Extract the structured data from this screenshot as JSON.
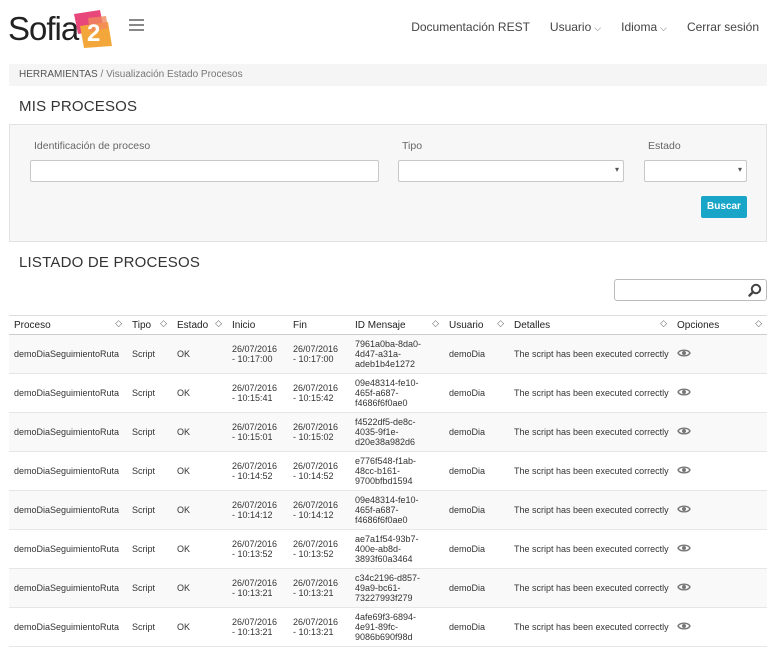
{
  "brand": {
    "name": "Sofia",
    "mark": "2",
    "colors": {
      "mark_primary": "#e8477b",
      "mark_secondary": "#f3a73b",
      "accent": "#19a5c8"
    }
  },
  "nav": {
    "items": [
      {
        "label": "Documentación REST",
        "has_caret": false
      },
      {
        "label": "Usuario",
        "has_caret": true
      },
      {
        "label": "Idioma",
        "has_caret": true
      },
      {
        "label": "Cerrar sesión",
        "has_caret": false
      }
    ]
  },
  "breadcrumb": {
    "root": "HERRAMIENTAS",
    "separator": "/",
    "current": "Visualización Estado Procesos"
  },
  "filters": {
    "title": "MIS PROCESOS",
    "id_label": "Identificación de proceso",
    "id_value": "",
    "tipo_label": "Tipo",
    "tipo_value": "",
    "estado_label": "Estado",
    "estado_value": "",
    "search_button": "Buscar"
  },
  "list": {
    "title": "LISTADO DE PROCESOS",
    "search_value": "",
    "columns": [
      "Proceso",
      "Tipo",
      "Estado",
      "Inicio",
      "Fin",
      "ID Mensaje",
      "Usuario",
      "Detalles",
      "Opciones"
    ],
    "rows": [
      {
        "proceso": "demoDiaSeguimientoRuta",
        "tipo": "Script",
        "estado": "OK",
        "inicio": [
          "26/07/2016",
          "- 10:17:00"
        ],
        "fin": [
          "26/07/2016",
          "- 10:17:00"
        ],
        "id": [
          "7961a0ba-8da0-",
          "4d47-a31a-",
          "adeb1b4e1272"
        ],
        "usuario": "demoDia",
        "detalles": "The script has been executed correctly"
      },
      {
        "proceso": "demoDiaSeguimientoRuta",
        "tipo": "Script",
        "estado": "OK",
        "inicio": [
          "26/07/2016",
          "- 10:15:41"
        ],
        "fin": [
          "26/07/2016",
          "- 10:15:42"
        ],
        "id": [
          "09e48314-fe10-",
          "465f-a687-",
          "f4686f6f0ae0"
        ],
        "usuario": "demoDia",
        "detalles": "The script has been executed correctly"
      },
      {
        "proceso": "demoDiaSeguimientoRuta",
        "tipo": "Script",
        "estado": "OK",
        "inicio": [
          "26/07/2016",
          "- 10:15:01"
        ],
        "fin": [
          "26/07/2016",
          "- 10:15:02"
        ],
        "id": [
          "f4522df5-de8c-",
          "4035-9f1e-",
          "d20e38a982d6"
        ],
        "usuario": "demoDia",
        "detalles": "The script has been executed correctly"
      },
      {
        "proceso": "demoDiaSeguimientoRuta",
        "tipo": "Script",
        "estado": "OK",
        "inicio": [
          "26/07/2016",
          "- 10:14:52"
        ],
        "fin": [
          "26/07/2016",
          "- 10:14:52"
        ],
        "id": [
          "e776f548-f1ab-",
          "48cc-b161-",
          "9700bfbd1594"
        ],
        "usuario": "demoDia",
        "detalles": "The script has been executed correctly"
      },
      {
        "proceso": "demoDiaSeguimientoRuta",
        "tipo": "Script",
        "estado": "OK",
        "inicio": [
          "26/07/2016",
          "- 10:14:12"
        ],
        "fin": [
          "26/07/2016",
          "- 10:14:12"
        ],
        "id": [
          "09e48314-fe10-",
          "465f-a687-",
          "f4686f6f0ae0"
        ],
        "usuario": "demoDia",
        "detalles": "The script has been executed correctly"
      },
      {
        "proceso": "demoDiaSeguimientoRuta",
        "tipo": "Script",
        "estado": "OK",
        "inicio": [
          "26/07/2016",
          "- 10:13:52"
        ],
        "fin": [
          "26/07/2016",
          "- 10:13:52"
        ],
        "id": [
          "ae7a1f54-93b7-",
          "400e-ab8d-",
          "3893f60a3464"
        ],
        "usuario": "demoDia",
        "detalles": "The script has been executed correctly"
      },
      {
        "proceso": "demoDiaSeguimientoRuta",
        "tipo": "Script",
        "estado": "OK",
        "inicio": [
          "26/07/2016",
          "- 10:13:21"
        ],
        "fin": [
          "26/07/2016",
          "- 10:13:21"
        ],
        "id": [
          "c34c2196-d857-",
          "49a9-bc61-",
          "73227993f279"
        ],
        "usuario": "demoDia",
        "detalles": "The script has been executed correctly"
      },
      {
        "proceso": "demoDiaSeguimientoRuta",
        "tipo": "Script",
        "estado": "OK",
        "inicio": [
          "26/07/2016",
          "- 10:13:21"
        ],
        "fin": [
          "26/07/2016",
          "- 10:13:21"
        ],
        "id": [
          "4afe69f3-6894-",
          "4e91-89fc-",
          "9086b690f98d"
        ],
        "usuario": "demoDia",
        "detalles": "The script has been executed correctly"
      }
    ]
  },
  "icons": {
    "menu": "hamburger-icon",
    "search": "search-icon",
    "caret": "chevron-down-icon",
    "sort": "sort-icon",
    "view": "eye-icon"
  }
}
